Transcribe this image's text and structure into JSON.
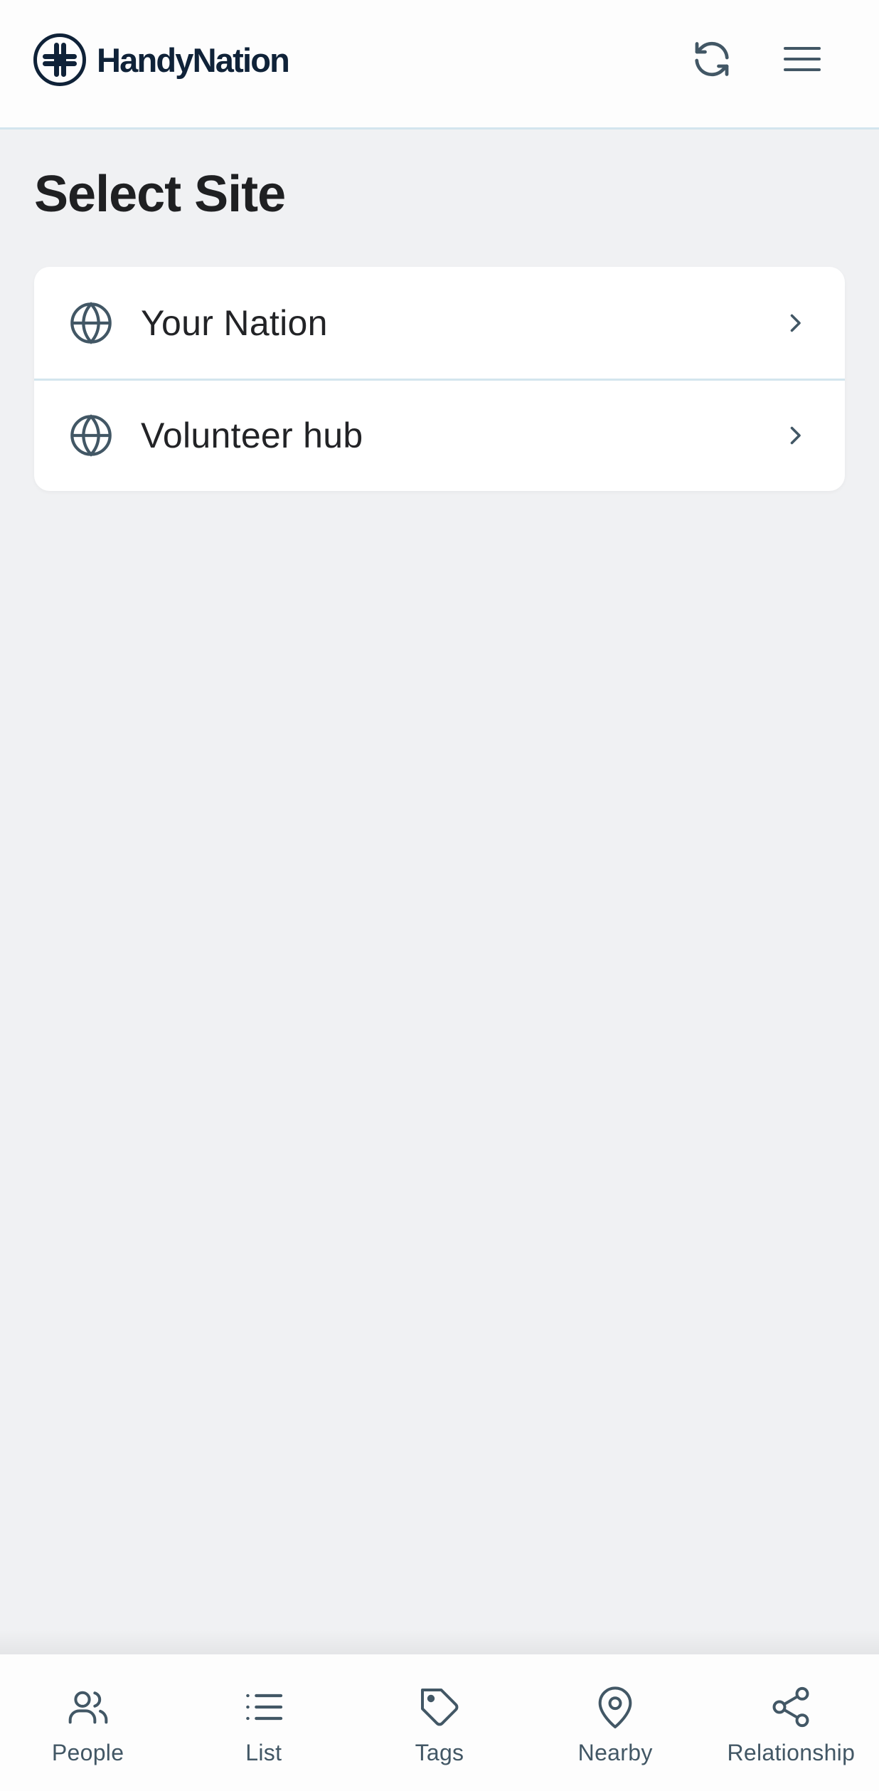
{
  "header": {
    "brand": "HandyNation",
    "refresh_icon": "refresh-icon",
    "menu_icon": "hamburger-menu-icon"
  },
  "main": {
    "title": "Select Site",
    "sites": [
      {
        "label": "Your Nation",
        "icon": "globe-icon"
      },
      {
        "label": "Volunteer hub",
        "icon": "globe-icon"
      }
    ]
  },
  "bottom_nav": {
    "items": [
      {
        "label": "People",
        "icon": "people-icon"
      },
      {
        "label": "List",
        "icon": "list-icon"
      },
      {
        "label": "Tags",
        "icon": "tag-icon"
      },
      {
        "label": "Nearby",
        "icon": "map-pin-icon"
      },
      {
        "label": "Relationship",
        "icon": "share-icon"
      }
    ]
  },
  "colors": {
    "brand_dark": "#0f2238",
    "icon_gray": "#425765",
    "divider": "#d3e5ee",
    "background": "#f0f1f3"
  }
}
